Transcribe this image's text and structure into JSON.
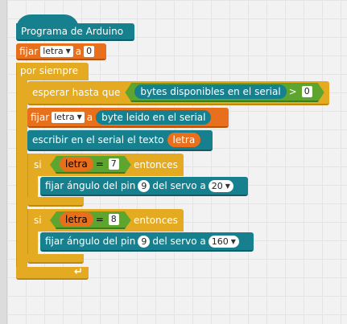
{
  "program": {
    "title": "Programa de Arduino",
    "set_label": "fijar",
    "set_var": "letra",
    "set_to": "a",
    "set_value": "0"
  },
  "loop": {
    "label": "por siempre",
    "wait_label": "esperar hasta que",
    "bytes_available": "bytes disponibles en el serial",
    "gt_op": ">",
    "gt_value": "0",
    "set2_label": "fijar",
    "set2_var": "letra",
    "set2_to": "a",
    "read_byte": "byte leido en el serial",
    "write_label": "escribir en el serial el texto",
    "write_var": "letra"
  },
  "if_blocks": [
    {
      "if_label": "si",
      "var": "letra",
      "op": "=",
      "compare": "7",
      "then_label": "entonces",
      "servo_label": "fijar ángulo del pin",
      "pin": "9",
      "servo_mid": "del servo a",
      "angle": "20"
    },
    {
      "if_label": "si",
      "var": "letra",
      "op": "=",
      "compare": "8",
      "then_label": "entonces",
      "servo_label": "fijar ángulo del pin",
      "pin": "9",
      "servo_mid": "del servo a",
      "angle": "160"
    }
  ],
  "colors": {
    "teal": "#17808f",
    "orange": "#e8701d",
    "yellow": "#e3aa22",
    "green": "#5da52f"
  },
  "icons": {
    "dropdown": "triangle-down-icon",
    "loop_arrow": "return-arrow-icon"
  }
}
